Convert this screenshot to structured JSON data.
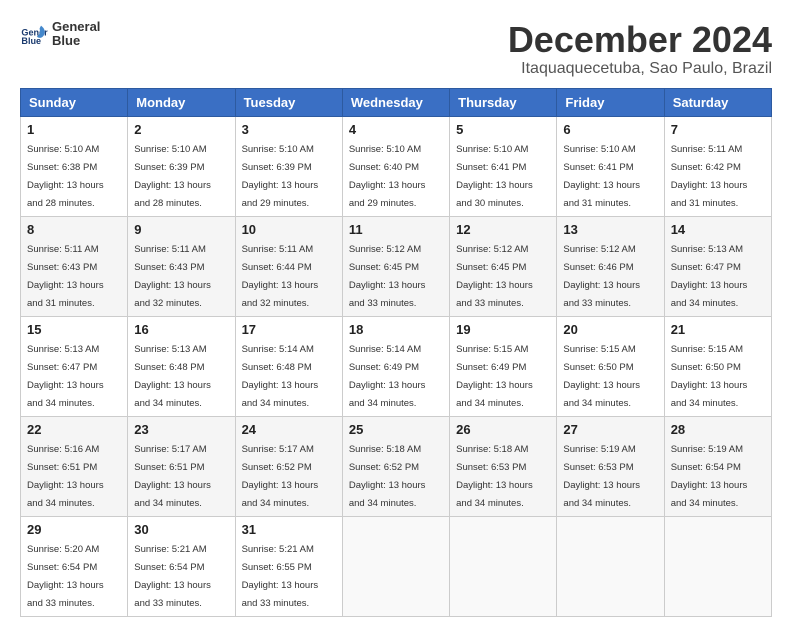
{
  "header": {
    "logo_line1": "General",
    "logo_line2": "Blue",
    "month_title": "December 2024",
    "location": "Itaquaquecetuba, Sao Paulo, Brazil"
  },
  "weekdays": [
    "Sunday",
    "Monday",
    "Tuesday",
    "Wednesday",
    "Thursday",
    "Friday",
    "Saturday"
  ],
  "weeks": [
    [
      {
        "day": "1",
        "sunrise": "5:10 AM",
        "sunset": "6:38 PM",
        "daylight": "13 hours and 28 minutes."
      },
      {
        "day": "2",
        "sunrise": "5:10 AM",
        "sunset": "6:39 PM",
        "daylight": "13 hours and 28 minutes."
      },
      {
        "day": "3",
        "sunrise": "5:10 AM",
        "sunset": "6:39 PM",
        "daylight": "13 hours and 29 minutes."
      },
      {
        "day": "4",
        "sunrise": "5:10 AM",
        "sunset": "6:40 PM",
        "daylight": "13 hours and 29 minutes."
      },
      {
        "day": "5",
        "sunrise": "5:10 AM",
        "sunset": "6:41 PM",
        "daylight": "13 hours and 30 minutes."
      },
      {
        "day": "6",
        "sunrise": "5:10 AM",
        "sunset": "6:41 PM",
        "daylight": "13 hours and 31 minutes."
      },
      {
        "day": "7",
        "sunrise": "5:11 AM",
        "sunset": "6:42 PM",
        "daylight": "13 hours and 31 minutes."
      }
    ],
    [
      {
        "day": "8",
        "sunrise": "5:11 AM",
        "sunset": "6:43 PM",
        "daylight": "13 hours and 31 minutes."
      },
      {
        "day": "9",
        "sunrise": "5:11 AM",
        "sunset": "6:43 PM",
        "daylight": "13 hours and 32 minutes."
      },
      {
        "day": "10",
        "sunrise": "5:11 AM",
        "sunset": "6:44 PM",
        "daylight": "13 hours and 32 minutes."
      },
      {
        "day": "11",
        "sunrise": "5:12 AM",
        "sunset": "6:45 PM",
        "daylight": "13 hours and 33 minutes."
      },
      {
        "day": "12",
        "sunrise": "5:12 AM",
        "sunset": "6:45 PM",
        "daylight": "13 hours and 33 minutes."
      },
      {
        "day": "13",
        "sunrise": "5:12 AM",
        "sunset": "6:46 PM",
        "daylight": "13 hours and 33 minutes."
      },
      {
        "day": "14",
        "sunrise": "5:13 AM",
        "sunset": "6:47 PM",
        "daylight": "13 hours and 34 minutes."
      }
    ],
    [
      {
        "day": "15",
        "sunrise": "5:13 AM",
        "sunset": "6:47 PM",
        "daylight": "13 hours and 34 minutes."
      },
      {
        "day": "16",
        "sunrise": "5:13 AM",
        "sunset": "6:48 PM",
        "daylight": "13 hours and 34 minutes."
      },
      {
        "day": "17",
        "sunrise": "5:14 AM",
        "sunset": "6:48 PM",
        "daylight": "13 hours and 34 minutes."
      },
      {
        "day": "18",
        "sunrise": "5:14 AM",
        "sunset": "6:49 PM",
        "daylight": "13 hours and 34 minutes."
      },
      {
        "day": "19",
        "sunrise": "5:15 AM",
        "sunset": "6:49 PM",
        "daylight": "13 hours and 34 minutes."
      },
      {
        "day": "20",
        "sunrise": "5:15 AM",
        "sunset": "6:50 PM",
        "daylight": "13 hours and 34 minutes."
      },
      {
        "day": "21",
        "sunrise": "5:15 AM",
        "sunset": "6:50 PM",
        "daylight": "13 hours and 34 minutes."
      }
    ],
    [
      {
        "day": "22",
        "sunrise": "5:16 AM",
        "sunset": "6:51 PM",
        "daylight": "13 hours and 34 minutes."
      },
      {
        "day": "23",
        "sunrise": "5:17 AM",
        "sunset": "6:51 PM",
        "daylight": "13 hours and 34 minutes."
      },
      {
        "day": "24",
        "sunrise": "5:17 AM",
        "sunset": "6:52 PM",
        "daylight": "13 hours and 34 minutes."
      },
      {
        "day": "25",
        "sunrise": "5:18 AM",
        "sunset": "6:52 PM",
        "daylight": "13 hours and 34 minutes."
      },
      {
        "day": "26",
        "sunrise": "5:18 AM",
        "sunset": "6:53 PM",
        "daylight": "13 hours and 34 minutes."
      },
      {
        "day": "27",
        "sunrise": "5:19 AM",
        "sunset": "6:53 PM",
        "daylight": "13 hours and 34 minutes."
      },
      {
        "day": "28",
        "sunrise": "5:19 AM",
        "sunset": "6:54 PM",
        "daylight": "13 hours and 34 minutes."
      }
    ],
    [
      {
        "day": "29",
        "sunrise": "5:20 AM",
        "sunset": "6:54 PM",
        "daylight": "13 hours and 33 minutes."
      },
      {
        "day": "30",
        "sunrise": "5:21 AM",
        "sunset": "6:54 PM",
        "daylight": "13 hours and 33 minutes."
      },
      {
        "day": "31",
        "sunrise": "5:21 AM",
        "sunset": "6:55 PM",
        "daylight": "13 hours and 33 minutes."
      },
      null,
      null,
      null,
      null
    ]
  ],
  "labels": {
    "sunrise_prefix": "Sunrise: ",
    "sunset_prefix": "Sunset: ",
    "daylight_prefix": "Daylight: "
  }
}
